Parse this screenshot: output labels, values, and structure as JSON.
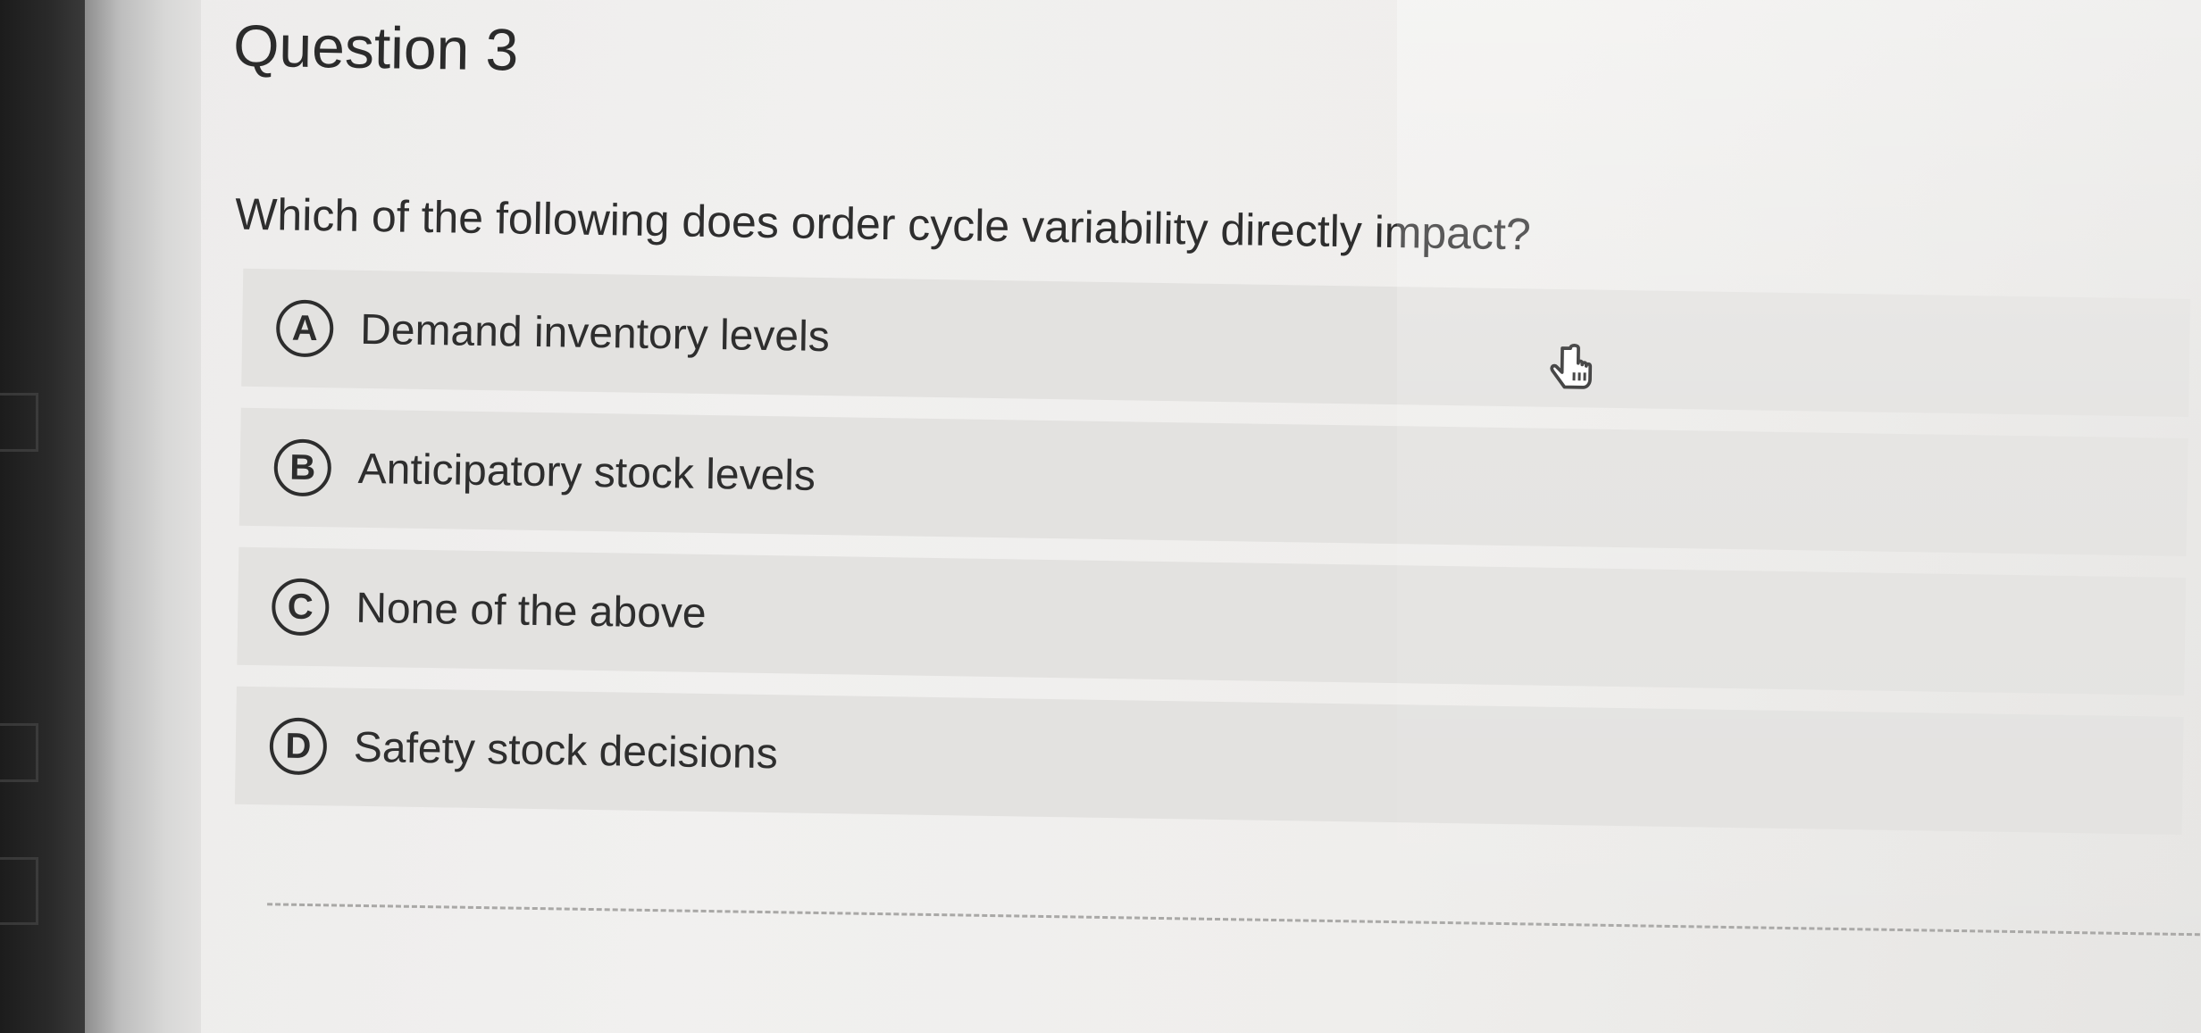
{
  "question": {
    "heading": "Question 3",
    "text": "Which of the following does order cycle variability directly impact?",
    "options": [
      {
        "letter": "A",
        "label": "Demand inventory levels"
      },
      {
        "letter": "B",
        "label": "Anticipatory stock levels"
      },
      {
        "letter": "C",
        "label": "None of the above"
      },
      {
        "letter": "D",
        "label": "Safety stock decisions"
      }
    ]
  },
  "icons": {
    "cursor": "hand-pointer-icon",
    "letter_badge": "circle-letter-icon"
  },
  "colors": {
    "option_background": "#e3e2e0",
    "text": "#2e2e2e",
    "page_background": "#efeeec"
  }
}
